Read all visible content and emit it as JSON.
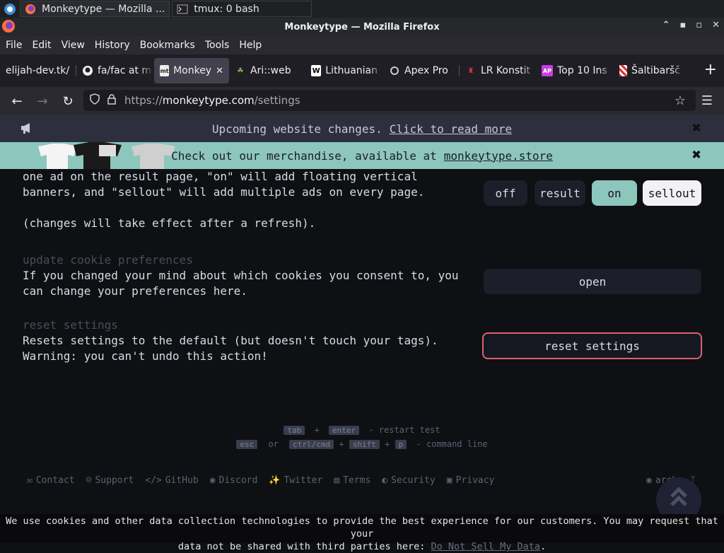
{
  "taskbar": {
    "tasks": [
      {
        "label": "Monkeytype — Mozilla ..."
      },
      {
        "label": "tmux: 0 bash"
      }
    ]
  },
  "window": {
    "title": "Monkeytype — Mozilla Firefox"
  },
  "menu": [
    "File",
    "Edit",
    "View",
    "History",
    "Bookmarks",
    "Tools",
    "Help"
  ],
  "tabs": [
    {
      "label": "elijah-dev.tk/",
      "icon": "none"
    },
    {
      "label": "fa/fac at m",
      "icon": "github-icon"
    },
    {
      "label": "Monkey",
      "icon": "monkeytype-icon",
      "active": true
    },
    {
      "label": "Ari::web",
      "icon": "ari-icon"
    },
    {
      "label": "Lithuanian",
      "icon": "wikipedia-icon"
    },
    {
      "label": "Apex Pro",
      "icon": "steelseries-icon"
    },
    {
      "label": "LR Konstit",
      "icon": "lr-icon"
    },
    {
      "label": "Top 10 Ins",
      "icon": "ap-icon"
    },
    {
      "label": "Šaltibaršč",
      "icon": "gingham-icon"
    }
  ],
  "urlbar": {
    "prefix": "https://",
    "host": "monkeytype.com",
    "path": "/settings"
  },
  "banners": {
    "notice_text": "Upcoming website changes.",
    "notice_link": "Click to read more",
    "merch_text": "Check out our merchandise, available at",
    "merch_link": "monkeytype.store"
  },
  "settings": {
    "ads": {
      "line1": "one ad on the result page, \"on\" will add floating vertical",
      "line2": "banners, and \"sellout\" will add multiple ads on every page.",
      "line3": "(changes will take effect after a refresh).",
      "options": [
        "off",
        "result",
        "on",
        "sellout"
      ],
      "selected": "on"
    },
    "cookie": {
      "title": "update cookie preferences",
      "line1": "If you changed your mind about which cookies you consent to, you",
      "line2": "can change your preferences here.",
      "button": "open"
    },
    "reset": {
      "title": "reset settings",
      "line1": "Resets settings to the default (but doesn't touch your tags).",
      "line2": "Warning: you can't undo this action!",
      "button": "reset settings"
    }
  },
  "hints": {
    "tab": "tab",
    "plus": "+",
    "enter": "enter",
    "restart": "- restart test",
    "esc": "esc",
    "or": "or",
    "ctrlcmd": "ctrl/cmd",
    "shift": "shift",
    "p": "p",
    "cmdline": "- command line"
  },
  "footer": {
    "links": [
      "Contact",
      "Support",
      "GitHub",
      "Discord",
      "Twitter",
      "Terms",
      "Security",
      "Privacy"
    ],
    "theme": "arch"
  },
  "cookie_notice": {
    "text1": "We use cookies and other data collection technologies to provide the best experience for our customers. You may request that your",
    "text2": "data not be shared with third parties here:",
    "link": "Do Not Sell My Data",
    "end": "."
  }
}
